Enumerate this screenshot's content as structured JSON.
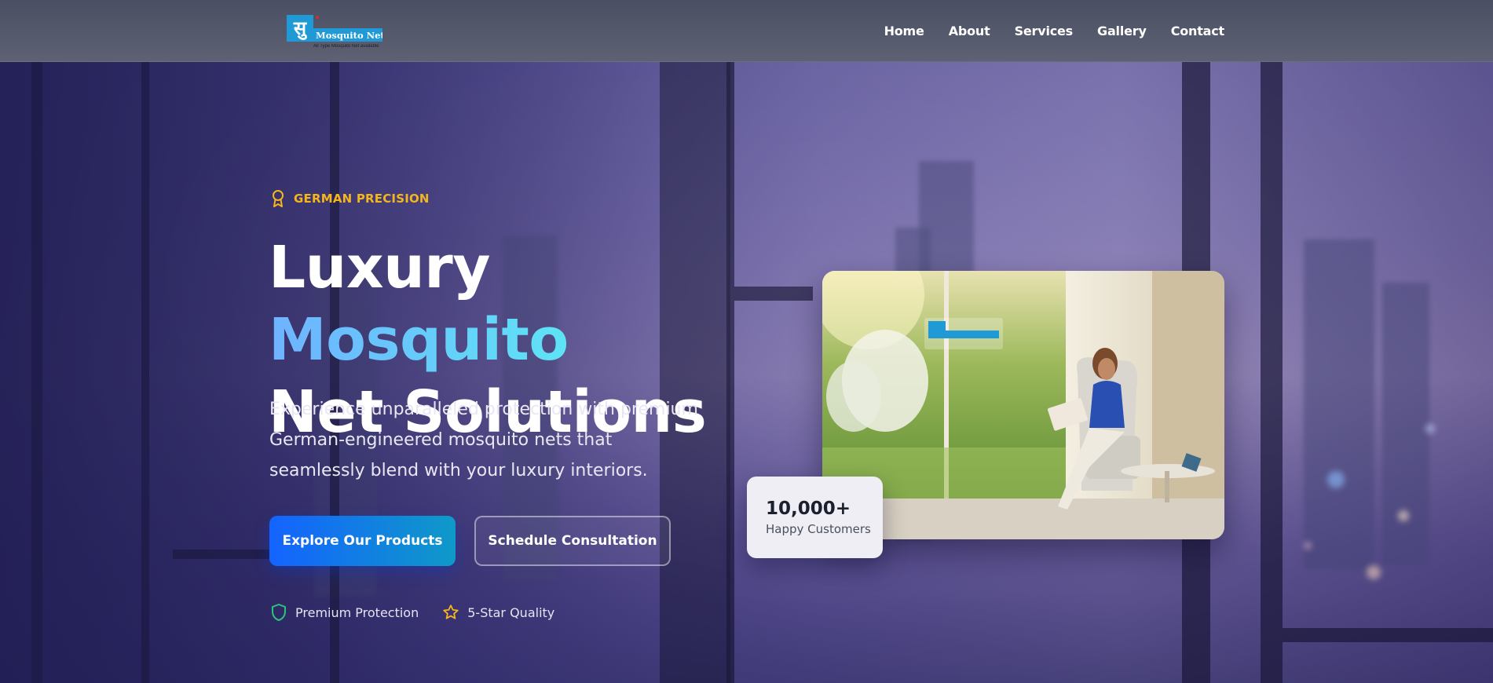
{
  "brand": {
    "glyph": "सु",
    "name": "Mosquito Net",
    "tagline": "All Type Mosquito Net available"
  },
  "nav": {
    "items": [
      "Home",
      "About",
      "Services",
      "Gallery",
      "Contact"
    ]
  },
  "hero": {
    "badge": "GERMAN PRECISION",
    "headline_part1": "Luxury",
    "headline_accent": "Mosquito",
    "headline_part2": "Net Solutions",
    "lead": "Experience unparalleled protection with premium German-engineered mosquito nets that seamlessly blend with your luxury interiors.",
    "primary_cta": "Explore Our Products",
    "secondary_cta": "Schedule Consultation",
    "features": [
      {
        "label": "Premium Protection",
        "icon": "shield-icon",
        "color": "#2ec27e"
      },
      {
        "label": "5-Star Quality",
        "icon": "star-icon",
        "color": "#f5b51d"
      }
    ]
  },
  "stat": {
    "value": "10,000+",
    "label": "Happy Customers"
  },
  "colors": {
    "badge": "#f5b51d",
    "accent_start": "#6fb2ff",
    "accent_end": "#5ee4f5",
    "primary_start": "#1463ff",
    "primary_end": "#0f99c8",
    "header_bg": "#545869"
  }
}
